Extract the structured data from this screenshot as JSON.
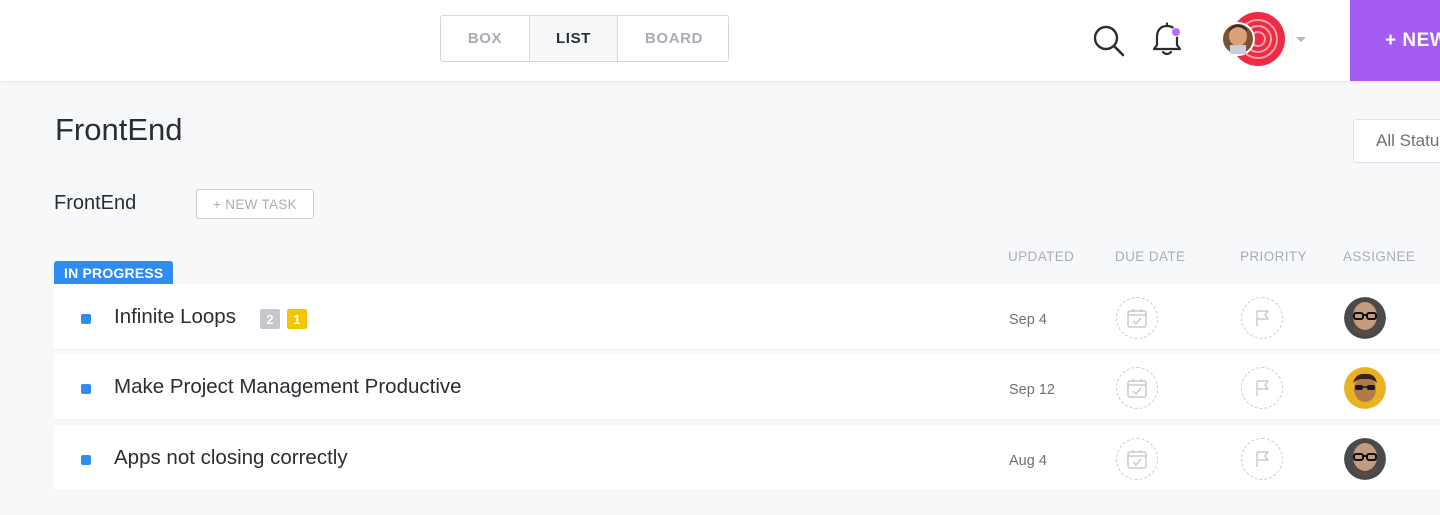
{
  "header": {
    "views": [
      {
        "label": "BOX",
        "active": false
      },
      {
        "label": "LIST",
        "active": true
      },
      {
        "label": "BOARD",
        "active": false
      }
    ],
    "new_button_label": "+ NEW",
    "accent_color": "#a55cf2",
    "notification_dot_color": "#b56ef5"
  },
  "page": {
    "title": "FrontEnd",
    "status_filter": "All Statuses"
  },
  "list": {
    "name": "FrontEnd",
    "new_task_label": "+ NEW TASK",
    "status_group": {
      "label": "IN PROGRESS",
      "color": "#2f8cf0"
    },
    "columns": {
      "updated": "UPDATED",
      "due_date": "DUE DATE",
      "priority": "PRIORITY",
      "assignee": "ASSIGNEE"
    },
    "tasks": [
      {
        "title": "Infinite Loops",
        "updated": "Sep 4",
        "badges": [
          "2",
          "1"
        ],
        "assignee_icon": "avatar-bald-glasses"
      },
      {
        "title": "Make Project Management Productive",
        "updated": "Sep 12",
        "badges": [],
        "assignee_icon": "avatar-sunglasses"
      },
      {
        "title": "Apps not closing correctly",
        "updated": "Aug 4",
        "badges": [],
        "assignee_icon": "avatar-bald-glasses"
      }
    ]
  }
}
